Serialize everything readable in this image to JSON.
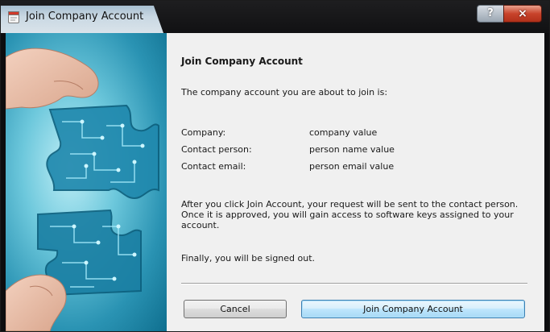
{
  "window": {
    "title": "Join Company Account",
    "help_label": "?",
    "close_label": "×"
  },
  "dialog": {
    "heading": "Join Company Account",
    "intro": "The company account you are about to join is:",
    "fields": [
      {
        "label": "Company:",
        "value": "company value"
      },
      {
        "label": "Contact person:",
        "value": "person name value"
      },
      {
        "label": "Contact email:",
        "value": "person email value"
      }
    ],
    "paragraph": "After you click Join Account, your request will be sent to the contact person. Once it is approved, you will gain access to software keys assigned to your account.",
    "signout_note": "Finally, you will be signed out."
  },
  "buttons": {
    "cancel": "Cancel",
    "join": "Join Company Account"
  },
  "colors": {
    "close_red": "#c8432b",
    "primary_blue": "#3c7fb1",
    "hero_cyan": "#6dc8dc"
  },
  "icons": {
    "app": "app-window-icon",
    "hero": "puzzle-hands-illustration"
  }
}
